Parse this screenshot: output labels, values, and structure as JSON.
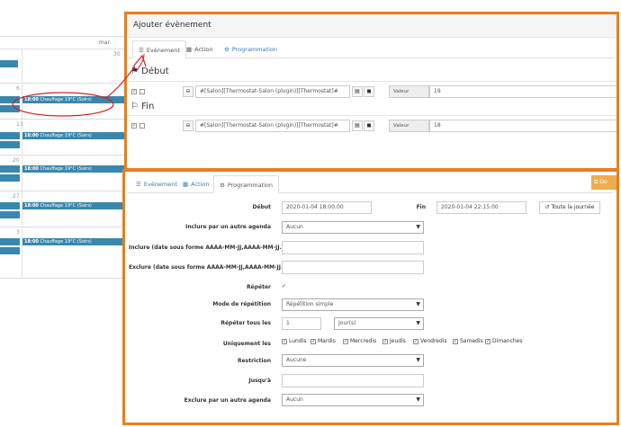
{
  "calendar": {
    "day_header": "mar.",
    "day_numbers": [
      "30",
      "6",
      "13",
      "20",
      "27",
      "3"
    ],
    "events": [
      {
        "time": "18:00",
        "title": "Chauffage 19°C (Soirs)"
      },
      {
        "time": "18:00",
        "title": "Chauffage 19°C (Soirs)"
      },
      {
        "time": "18:00",
        "title": "Chauffage 19°C (Soirs)"
      },
      {
        "time": "18:00",
        "title": "Chauffage 19°C (Soirs)"
      },
      {
        "time": "18:00",
        "title": "Chauffage 19°C (Soirs)"
      }
    ]
  },
  "modal_top": {
    "title": "Ajouter évènement",
    "tabs": [
      {
        "label": "Evènement",
        "icon": "list-icon"
      },
      {
        "label": "Action",
        "icon": "calendar-icon"
      },
      {
        "label": "Programmation",
        "icon": "gears-icon"
      }
    ],
    "start_heading": "Début",
    "end_heading": "Fin",
    "start_command": "#[Salon][Thermostat-Salon (plugin)][Thermostat]#",
    "end_command": "#[Salon][Thermostat-Salon (plugin)][Thermostat]#",
    "value_label": "Valeur",
    "start_value": "19",
    "end_value": "18"
  },
  "modal_bottom": {
    "tabs": [
      {
        "label": "Evènement",
        "icon": "list-icon"
      },
      {
        "label": "Action",
        "icon": "calendar-icon"
      },
      {
        "label": "Programmation",
        "icon": "gears-icon"
      }
    ],
    "corner_button": "Du",
    "start_label": "Début",
    "start_value": "2020-01-04 18:00:00",
    "end_label": "Fin",
    "end_value": "2020-01-04 22:15:00",
    "all_day_button": "Toute la journée",
    "include_agenda_label": "Inclure par un autre agenda",
    "include_agenda_value": "Aucun",
    "include_dates_label": "Inclure (date sous forme AAAA-MM-JJ,AAAA-MM-JJ....)",
    "exclude_dates_label": "Exclure (date sous forme AAAA-MM-JJ,AAAA-MM-JJ....)",
    "repeat_label": "Répéter",
    "repeat_mode_label": "Mode de répétition",
    "repeat_mode_value": "Répétition simple",
    "repeat_every_label": "Répéter tous les",
    "repeat_every_value": "1",
    "repeat_unit_value": "Jour(s)",
    "only_days_label": "Uniquement les",
    "days": [
      "Lundis",
      "Mardis",
      "Mercredis",
      "Jeudis",
      "Vendredis",
      "Samedis",
      "Dimanches"
    ],
    "restriction_label": "Restriction",
    "restriction_value": "Aucune",
    "until_label": "Jusqu'à",
    "exclude_agenda_label": "Exclure par un autre agenda",
    "exclude_agenda_value": "Aucun"
  },
  "colors": {
    "accent_border": "#e67e22",
    "event_blue": "#3a87ad",
    "annotation_red": "#d62020"
  }
}
